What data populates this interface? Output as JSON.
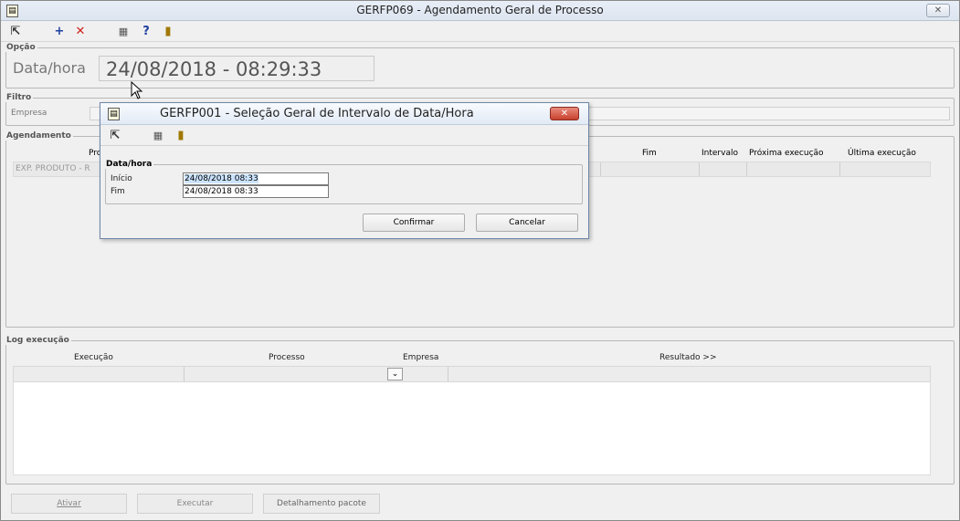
{
  "window": {
    "title": "GERFP069 - Agendamento Geral de Processo",
    "close": "✕"
  },
  "toolbar": {
    "icons": [
      "exit-arrow-icon",
      "add-icon",
      "delete-icon",
      "calendar-icon",
      "help-icon",
      "door-exit-icon"
    ]
  },
  "opcao": {
    "legend": "Opção",
    "label": "Data/hora",
    "value": "24/08/2018  -  08:29:33"
  },
  "filtro": {
    "legend": "Filtro",
    "empresa_label": "Empresa"
  },
  "agendamento": {
    "legend": "Agendamento",
    "columns": {
      "processo": "Pro",
      "fim": "Fim",
      "intervalo": "Intervalo",
      "proxima": "Próxima execução",
      "ultima": "Última execução"
    },
    "row_text": "EXP. PRODUTO - R"
  },
  "log": {
    "legend": "Log execução",
    "columns": {
      "execucao": "Execução",
      "processo": "Processo",
      "empresa": "Empresa",
      "resultado": "Resultado >>"
    }
  },
  "buttons": {
    "ativar": "Ativar",
    "executar": "Executar",
    "detalhamento": "Detalhamento pacote"
  },
  "dialog": {
    "title": "GERFP001 - Seleção Geral de Intervalo de Data/Hora",
    "legend": "Data/hora",
    "inicio_label": "Início",
    "inicio_value": "24/08/2018 08:33",
    "fim_label": "Fim",
    "fim_value": "24/08/2018 08:33",
    "confirmar": "Confirmar",
    "cancelar": "Cancelar"
  },
  "colors": {
    "close_red": "#c9412f",
    "selection": "#cce4ff"
  }
}
